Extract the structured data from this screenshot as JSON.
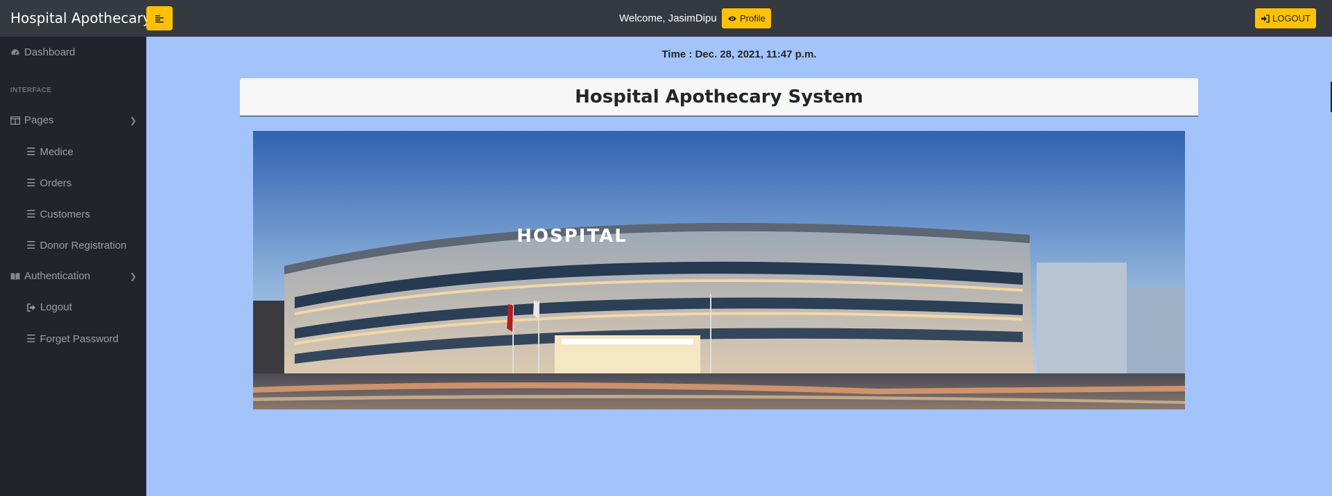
{
  "app": {
    "brand": "Hospital Apothecary",
    "welcome": "Welcome, JasimDipu",
    "profile_label": "Profile",
    "logout_label": "LOGOUT"
  },
  "sidebar": {
    "dashboard": "Dashboard",
    "heading": "INTERFACE",
    "pages": "Pages",
    "items": [
      "Medice",
      "Orders",
      "Customers",
      "Donor Registration"
    ],
    "authentication": "Authentication",
    "auth_items": [
      "Logout",
      "Forget Password"
    ]
  },
  "main": {
    "time": "Time : Dec. 28, 2021, 11:47 p.m.",
    "title": "Hospital Apothecary System",
    "hero_sign": "HOSPITAL"
  },
  "colors": {
    "accent": "#ffc107",
    "topbar": "#343a40",
    "sidebar": "#212529",
    "page_bg": "#a3c3fb"
  }
}
